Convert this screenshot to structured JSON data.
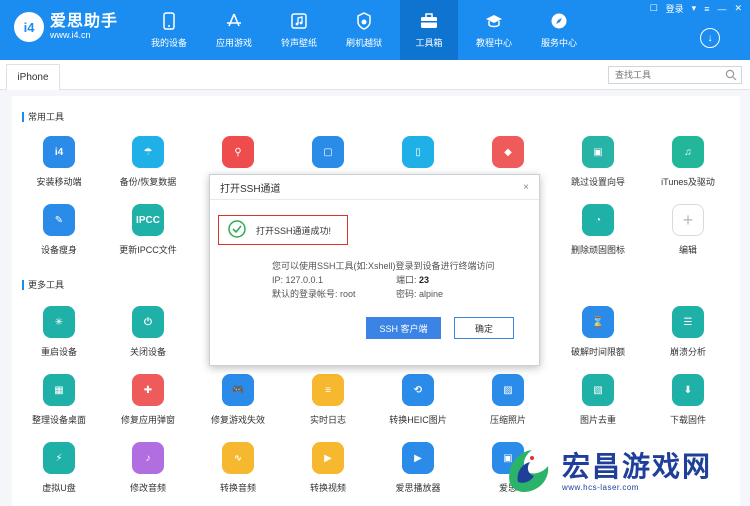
{
  "app": {
    "logo_mark": "i4",
    "logo_name": "爱思助手",
    "logo_url": "www.i4.cn"
  },
  "nav": [
    {
      "label": "我的设备",
      "icon": "phone-icon"
    },
    {
      "label": "应用游戏",
      "icon": "app-store-icon"
    },
    {
      "label": "铃声壁纸",
      "icon": "music-icon"
    },
    {
      "label": "刷机越狱",
      "icon": "flash-icon"
    },
    {
      "label": "工具箱",
      "icon": "toolbox-icon",
      "active": true
    },
    {
      "label": "教程中心",
      "icon": "graduation-cap-icon"
    },
    {
      "label": "服务中心",
      "icon": "compass-icon"
    }
  ],
  "topbar": {
    "login": "登录"
  },
  "tabbar": {
    "device_tab": "iPhone",
    "search_placeholder": "查找工具"
  },
  "sections": {
    "common": "常用工具",
    "more": "更多工具"
  },
  "common_tools": [
    {
      "label": "安装移动端",
      "color": "#2b8be8",
      "icon": "i4-icon",
      "glyph": "i4"
    },
    {
      "label": "备份/恢复数据",
      "color": "#1fb0e8",
      "icon": "umbrella-icon",
      "glyph": "☂"
    },
    {
      "label": "跳过设置向导",
      "color": "#27b3a6",
      "icon": "guide-icon",
      "glyph": "▣"
    },
    {
      "label": "iTunes及驱动",
      "color": "#22b79a",
      "icon": "itunes-icon",
      "glyph": "♫"
    },
    {
      "label": "设备瘦身",
      "color": "#2b8be8",
      "icon": "broom-icon",
      "glyph": "✎"
    },
    {
      "label": "更新IPCC文件",
      "color": "#1fb0a8",
      "icon": "ipcc-icon",
      "glyph": "IPCC"
    },
    {
      "label": "删除顽固图标",
      "color": "#1fb0a8",
      "icon": "pie-icon",
      "glyph": "◔"
    },
    {
      "label": "编辑",
      "color": "#ffffff",
      "icon": "plus-icon",
      "glyph": "+"
    }
  ],
  "partial_common_icons": [
    {
      "color": "#ef4d4d",
      "icon": "location-icon",
      "glyph": "⚲"
    },
    {
      "color": "#2b8be8",
      "icon": "screen-mirror-icon",
      "glyph": "▢"
    },
    {
      "color": "#1fb0e8",
      "icon": "phone-screen-icon",
      "glyph": "▯"
    },
    {
      "color": "#ef5a5a",
      "icon": "eraser-icon",
      "glyph": "◆"
    }
  ],
  "more_tools": [
    {
      "label": "重启设备",
      "color": "#1fb0a8",
      "icon": "restart-icon",
      "glyph": "✳"
    },
    {
      "label": "关闭设备",
      "color": "#1fb0a8",
      "icon": "power-icon",
      "glyph": "⏻"
    },
    {
      "label": "破解时间限额",
      "color": "#2b8be8",
      "icon": "hourglass-icon",
      "glyph": "⌛"
    },
    {
      "label": "崩溃分析",
      "color": "#1fb0a8",
      "icon": "report-icon",
      "glyph": "☰"
    },
    {
      "label": "整理设备桌面",
      "color": "#1fb0a8",
      "icon": "grid-icon",
      "glyph": "▦"
    },
    {
      "label": "修复应用弹窗",
      "color": "#ef5a5a",
      "icon": "repair-icon",
      "glyph": "✚"
    },
    {
      "label": "修复游戏失效",
      "color": "#2b8be8",
      "icon": "gamepad-icon",
      "glyph": "🎮"
    },
    {
      "label": "实时日志",
      "color": "#f5b82e",
      "icon": "log-icon",
      "glyph": "≡"
    },
    {
      "label": "转换HEIC图片",
      "color": "#2b8be8",
      "icon": "heic-icon",
      "glyph": "⟲"
    },
    {
      "label": "压缩照片",
      "color": "#2b8be8",
      "icon": "photo-icon",
      "glyph": "▨"
    },
    {
      "label": "图片去重",
      "color": "#1fb0a8",
      "icon": "dedupe-icon",
      "glyph": "▧"
    },
    {
      "label": "下载固件",
      "color": "#1fb0a8",
      "icon": "firmware-icon",
      "glyph": "⬇"
    },
    {
      "label": "虚拟U盘",
      "color": "#1fb0a8",
      "icon": "usb-icon",
      "glyph": "⚡"
    },
    {
      "label": "修改音频",
      "color": "#b06ee0",
      "icon": "audio-edit-icon",
      "glyph": "♪"
    },
    {
      "label": "转换音频",
      "color": "#f5b82e",
      "icon": "audio-wave-icon",
      "glyph": "∿"
    },
    {
      "label": "转换视频",
      "color": "#f5b82e",
      "icon": "video-icon",
      "glyph": "▶"
    },
    {
      "label": "爱思播放器",
      "color": "#2b8be8",
      "icon": "player-icon",
      "glyph": "▶"
    },
    {
      "label": "爱思",
      "color": "#2b8be8",
      "icon": "app-icon",
      "glyph": "▣"
    }
  ],
  "modal": {
    "title": "打开SSH通道",
    "close": "×",
    "success": "打开SSH通道成功!",
    "hint": "您可以使用SSH工具(如:Xshell)登录到设备进行终端访问",
    "ip_label": "IP:",
    "ip_value": "127.0.0.1",
    "port_label": "端口:",
    "port_value": "23",
    "account_label": "默认的登录帐号:",
    "account_value": "root",
    "password_label": "密码:",
    "password_value": "alpine",
    "ssh_client_button": "SSH 客户端",
    "ok_button": "确定"
  },
  "watermark": {
    "title": "宏昌游戏网",
    "url": "www.hcs-laser.com"
  },
  "colors": {
    "brand": "#1c8df0",
    "success": "#2eaa4f",
    "highlight": "#d9342b"
  }
}
